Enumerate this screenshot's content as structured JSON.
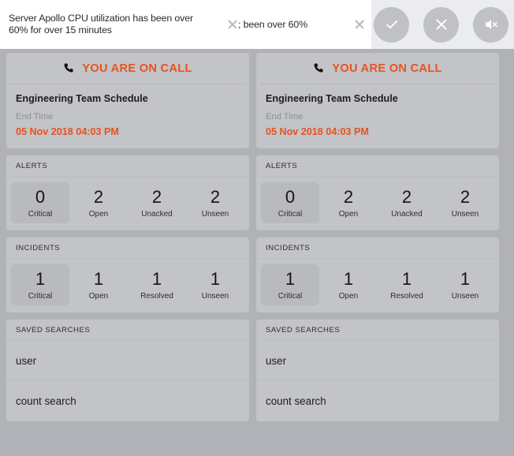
{
  "notifications": {
    "toasts": [
      {
        "message": "Server Apollo CPU utilization has been over 60% for over 15 minutes",
        "close_label": "close-icon"
      },
      {
        "message": "; been over 60%",
        "close_label": "close-icon"
      }
    ],
    "actions": [
      {
        "name": "acknowledge-button",
        "icon": "check-icon"
      },
      {
        "name": "dismiss-button",
        "icon": "close-icon"
      },
      {
        "name": "mute-button",
        "icon": "speaker-mute-icon"
      }
    ]
  },
  "panel": {
    "oncall": {
      "icon": "phone-icon",
      "title": "YOU ARE ON CALL",
      "schedule_name": "Engineering Team Schedule",
      "end_time_label": "End Time",
      "end_time_value": "05 Nov 2018 04:03 PM"
    },
    "alerts": {
      "heading": "ALERTS",
      "stats": [
        {
          "value": "0",
          "label": "Critical",
          "active": true
        },
        {
          "value": "2",
          "label": "Open",
          "active": false
        },
        {
          "value": "2",
          "label": "Unacked",
          "active": false
        },
        {
          "value": "2",
          "label": "Unseen",
          "active": false
        }
      ]
    },
    "incidents": {
      "heading": "INCIDENTS",
      "stats": [
        {
          "value": "1",
          "label": "Critical",
          "active": true
        },
        {
          "value": "1",
          "label": "Open",
          "active": false
        },
        {
          "value": "1",
          "label": "Resolved",
          "active": false
        },
        {
          "value": "1",
          "label": "Unseen",
          "active": false
        }
      ]
    },
    "saved_searches": {
      "heading": "SAVED SEARCHES",
      "items": [
        {
          "label": "user"
        },
        {
          "label": "count search"
        }
      ]
    }
  },
  "colors": {
    "accent": "#e8521f",
    "background": "#b0b2b8",
    "card": "#c3c4c7",
    "active_tile": "#b9babe",
    "toast_bg": "#ffffff",
    "toast_actions_bg": "#ebecef",
    "circle_button": "#c0c1c4"
  }
}
